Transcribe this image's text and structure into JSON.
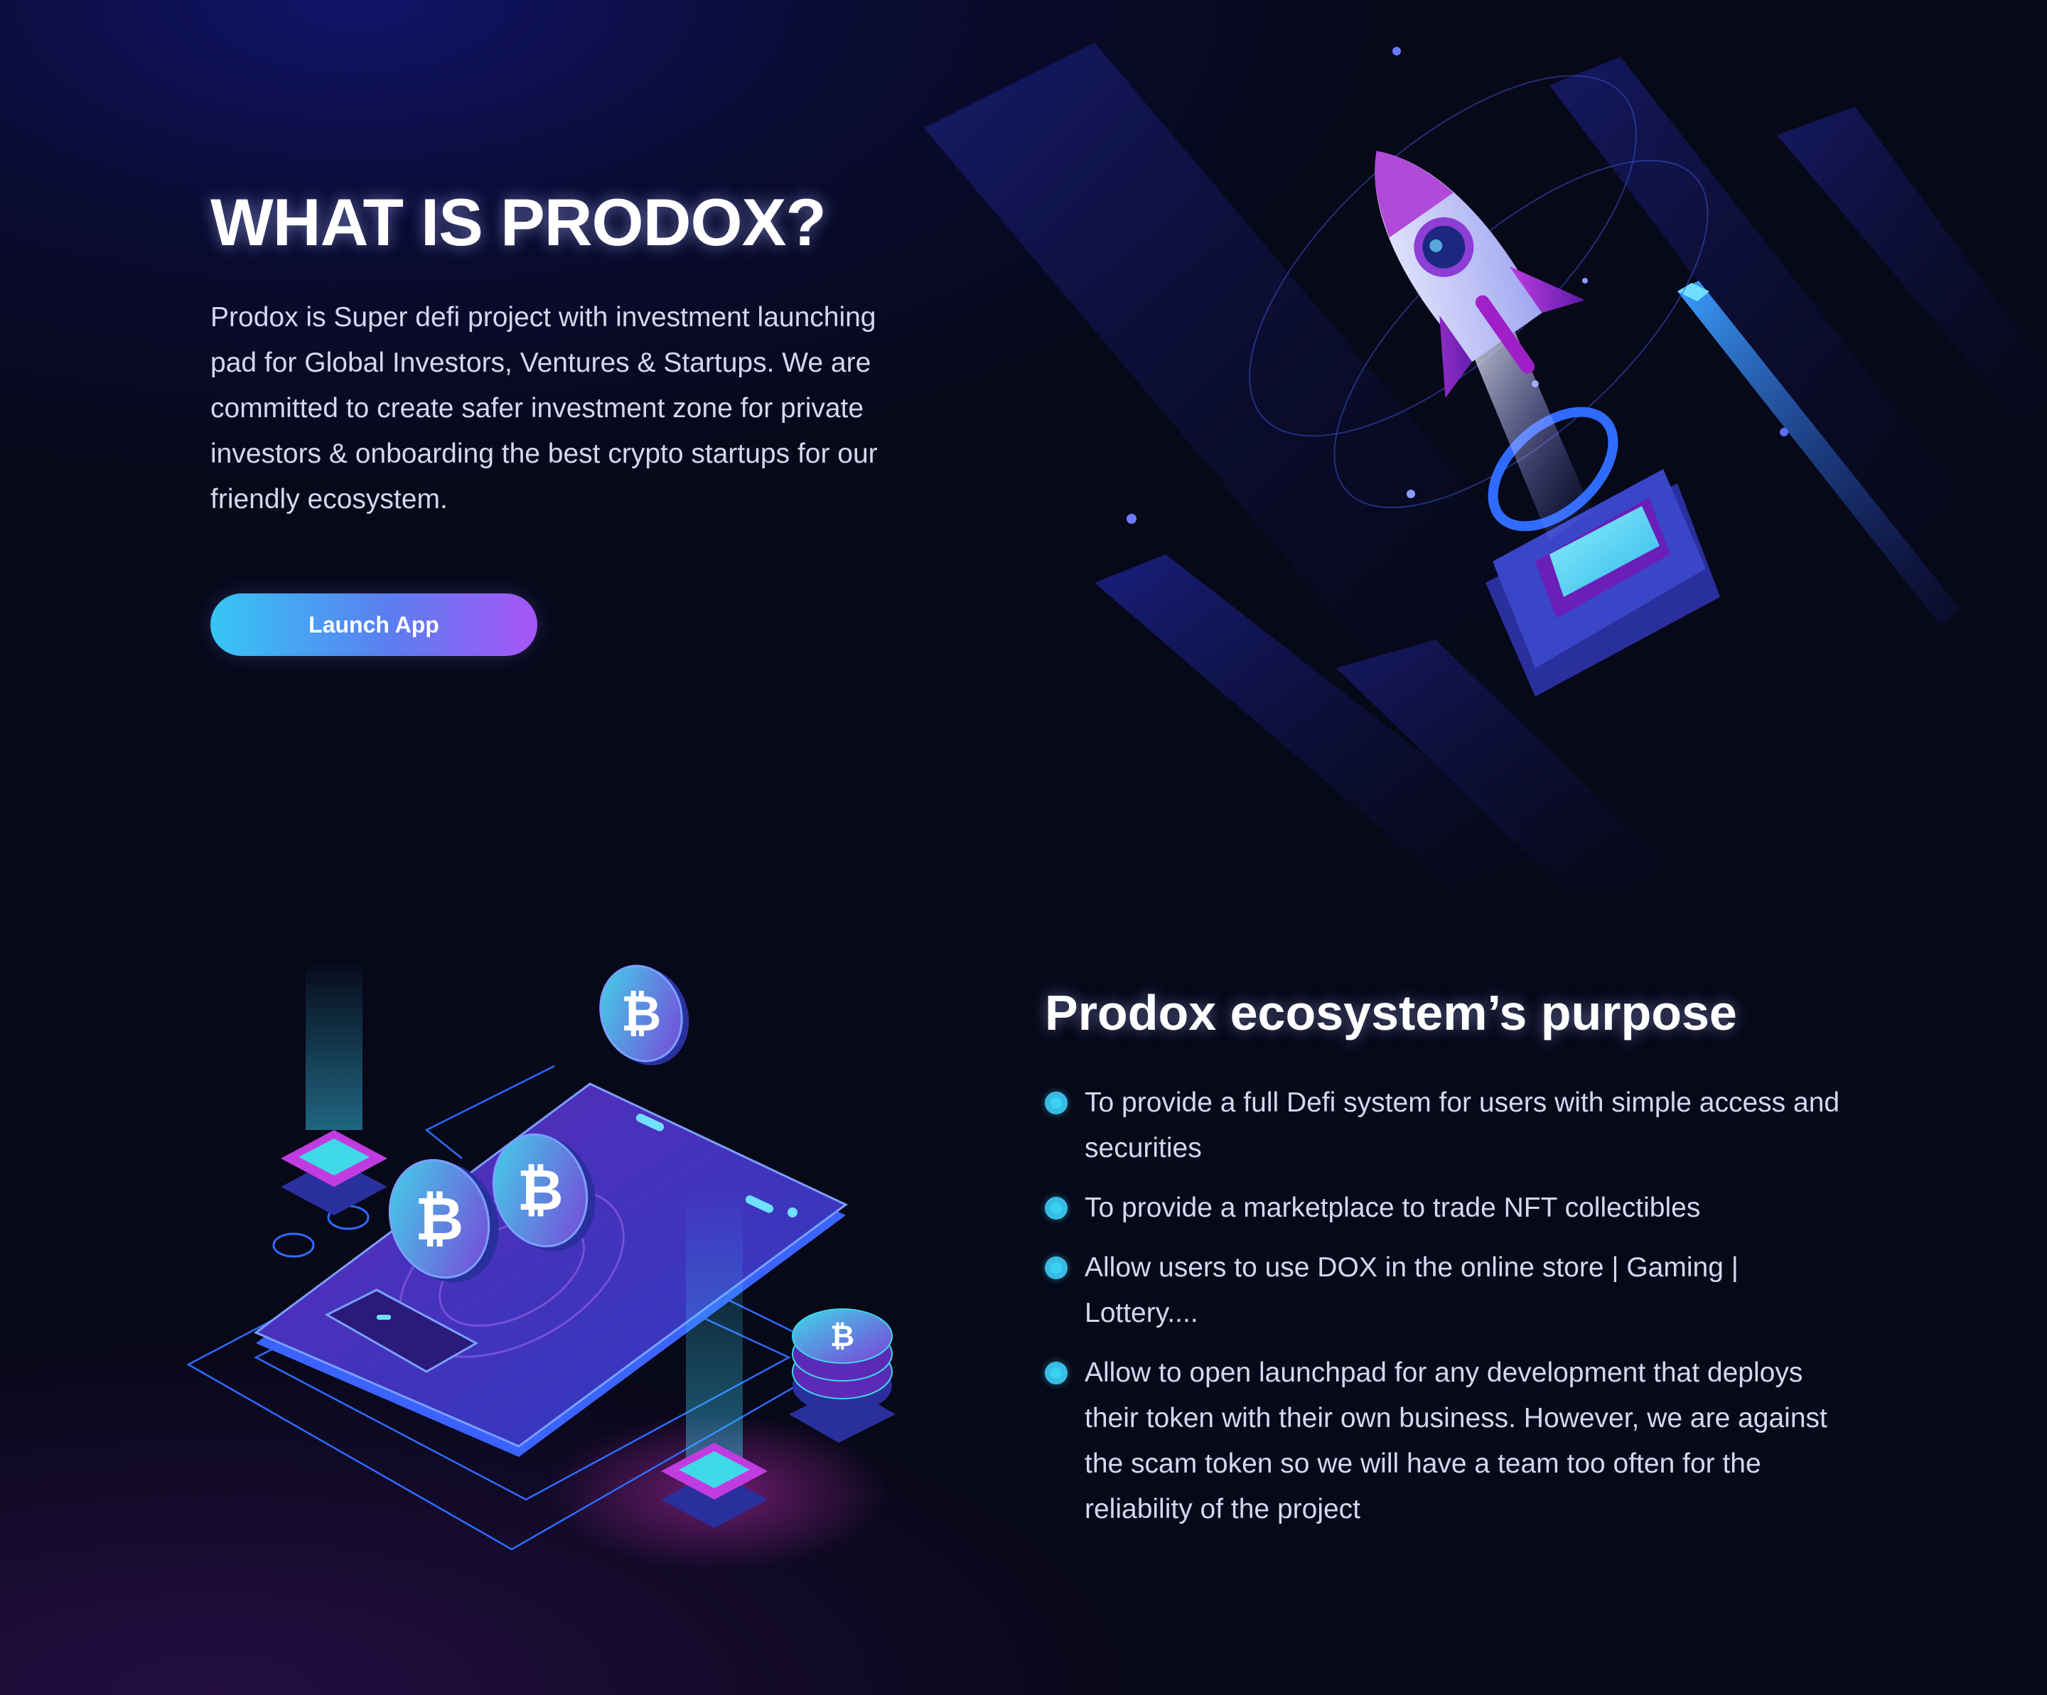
{
  "about": {
    "title": "WHAT IS PRODOX?",
    "description": "Prodox is Super defi project with investment launching pad for Global Investors, Ventures & Startups. We are committed to create safer investment zone for private investors & onboarding the best crypto startups for our friendly ecosystem.",
    "launch_button_label": "Launch App"
  },
  "purpose": {
    "title": "Prodox ecosystem’s purpose",
    "items": [
      {
        "text": "To provide a full Defi system for users with simple access and securities"
      },
      {
        "text": "To provide a marketplace to trade NFT collectibles"
      },
      {
        "text": "Allow users to use DOX in the online store | Gaming | Lottery...."
      },
      {
        "text": "Allow to open launchpad for any development that deploys their token with their own business. However, we are against the scam token so we will have a team too often for the reliability of the project"
      }
    ]
  },
  "illustrations": {
    "hero": "rocket-launch-illustration",
    "platform": "crypto-phone-platform-illustration",
    "coin_symbol": "₿"
  },
  "colors": {
    "background": "#070818",
    "accent_cyan": "#38d2f2",
    "accent_blue": "#5b7ef0",
    "accent_purple": "#a855f7",
    "body_text": "#d5d7ef"
  }
}
